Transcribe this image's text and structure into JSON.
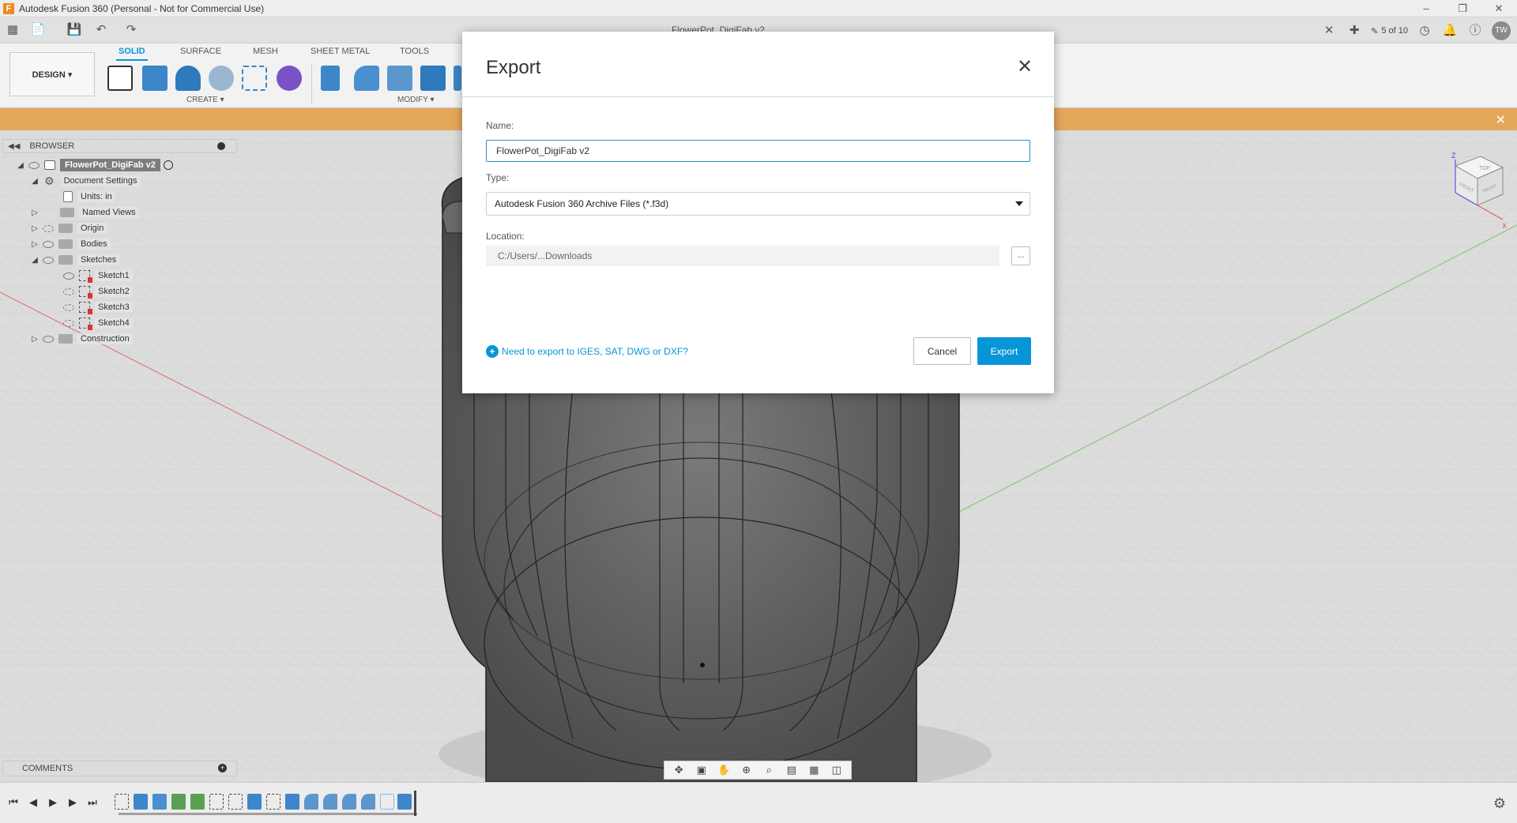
{
  "window": {
    "title": "Autodesk Fusion 360 (Personal - Not for Commercial Use)",
    "app_icon_letter": "F",
    "document_tab_title": "FlowerPot_DigiFab v2",
    "version_indicator": "5 of 10",
    "user_initials": "TW",
    "controls": [
      "minimize-icon",
      "restore-icon",
      "close-icon"
    ]
  },
  "ribbon": {
    "workspace_button": "DESIGN ▾",
    "tabs": [
      "SOLID",
      "SURFACE",
      "MESH",
      "SHEET METAL",
      "TOOLS"
    ],
    "active_tab": "SOLID",
    "groups": [
      "CREATE ▾",
      "MODIFY ▾"
    ]
  },
  "browser": {
    "header": "BROWSER",
    "root": "FlowerPot_DigiFab v2",
    "items": [
      {
        "label": "Document Settings"
      },
      {
        "label": "Units: in"
      },
      {
        "label": "Named Views"
      },
      {
        "label": "Origin"
      },
      {
        "label": "Bodies"
      },
      {
        "label": "Sketches"
      },
      {
        "label": "Sketch1"
      },
      {
        "label": "Sketch2"
      },
      {
        "label": "Sketch3"
      },
      {
        "label": "Sketch4"
      },
      {
        "label": "Construction"
      }
    ]
  },
  "comments": {
    "label": "COMMENTS"
  },
  "viewcube": {
    "top": "TOP",
    "front": "FRONT",
    "right": "RIGHT",
    "z": "Z",
    "x": "X"
  },
  "dialog": {
    "title": "Export",
    "name_label": "Name:",
    "name_value": "FlowerPot_DigiFab v2",
    "type_label": "Type:",
    "type_value": "Autodesk Fusion 360 Archive Files (*.f3d)",
    "location_label": "Location:",
    "location_value": "C:/Users/...Downloads",
    "browse_label": "...",
    "help_link": "Need to export to IGES, SAT, DWG or DXF?",
    "cancel_label": "Cancel",
    "export_label": "Export"
  },
  "colors": {
    "accent": "#0696d7",
    "notice_bar": "#e5a85a",
    "model_body": "#5e5e5e"
  }
}
